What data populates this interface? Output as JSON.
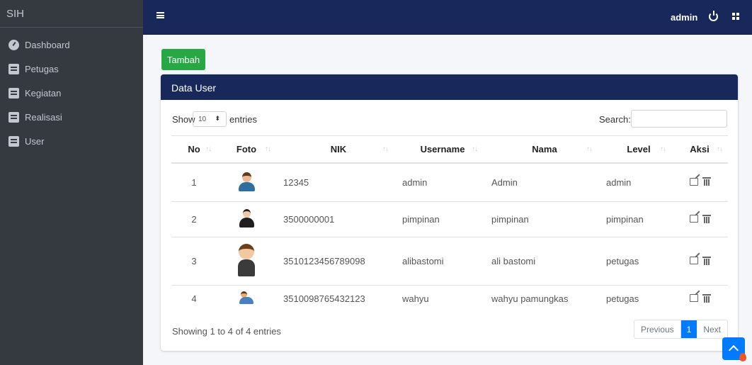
{
  "sidebar": {
    "brand": "SIH",
    "items": [
      {
        "label": "Dashboard",
        "icon": "dashboard-icon"
      },
      {
        "label": "Petugas",
        "icon": "book-icon"
      },
      {
        "label": "Kegiatan",
        "icon": "book-icon"
      },
      {
        "label": "Realisasi",
        "icon": "book-icon"
      },
      {
        "label": "User",
        "icon": "book-icon"
      }
    ]
  },
  "topbar": {
    "user": "admin",
    "colors": {
      "navbar": "#18285a",
      "sidebar": "#343a40"
    }
  },
  "main": {
    "add_button": "Tambah",
    "card_title": "Data User",
    "length_menu": {
      "show": "Show",
      "value": "10",
      "entries": "entries"
    },
    "search_label": "Search:",
    "columns": [
      "No",
      "Foto",
      "NIK",
      "Username",
      "Nama",
      "Level",
      "Aksi"
    ],
    "rows": [
      {
        "no": "1",
        "nik": "12345",
        "username": "admin",
        "nama": "Admin",
        "level": "admin"
      },
      {
        "no": "2",
        "nik": "3500000001",
        "username": "pimpinan",
        "nama": "pimpinan",
        "level": "pimpinan"
      },
      {
        "no": "3",
        "nik": "3510123456789098",
        "username": "alibastomi",
        "nama": "ali bastomi",
        "level": "petugas"
      },
      {
        "no": "4",
        "nik": "3510098765432123",
        "username": "wahyu",
        "nama": "wahyu pamungkas",
        "level": "petugas"
      }
    ],
    "info": "Showing 1 to 4 of 4 entries",
    "pagination": {
      "previous": "Previous",
      "current": "1",
      "next": "Next"
    }
  }
}
